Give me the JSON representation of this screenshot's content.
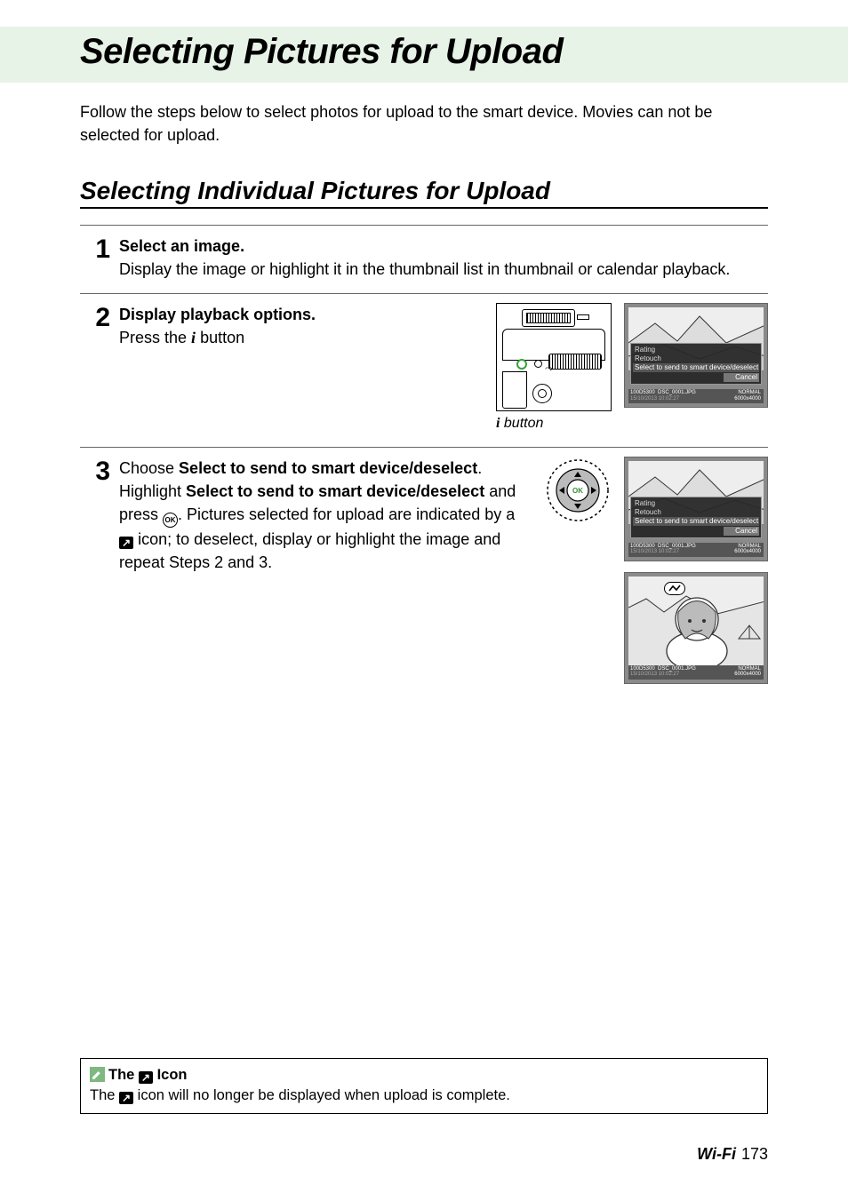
{
  "title": "Selecting Pictures for Upload",
  "intro": "Follow the steps below to select photos for upload to the smart device. Movies can not be selected for upload.",
  "subtitle": "Selecting Individual Pictures for Upload",
  "steps": {
    "s1": {
      "num": "1",
      "head": "Select an image.",
      "body": "Display the image or highlight it in the thumbnail list in thumbnail or calendar playback."
    },
    "s2": {
      "num": "2",
      "head": "Display playback options.",
      "body_pre": "Press the ",
      "i_symbol": "i",
      "body_post": " button",
      "caption_pre": "",
      "caption_i": "i",
      "caption_post": " button"
    },
    "s3": {
      "num": "3",
      "head_pre": "Choose ",
      "head_bold": "Select to send to smart device/deselect",
      "head_post": ".",
      "body_pre": "Highlight ",
      "body_bold": "Select to send to smart device/deselect",
      "body_mid": " and press ",
      "ok_label": "OK",
      "body_mid2": ". Pictures selected for upload are indicated by a ",
      "upload_icon": "✓",
      "body_post": " icon; to deselect, display or highlight the image and repeat Steps 2 and 3."
    }
  },
  "menu": {
    "rating": "Rating",
    "retouch": "Retouch",
    "select": "Select to send to smart device/deselect",
    "cancel": "Cancel"
  },
  "meta": {
    "folder": "100D5300",
    "file": "DSC_0001.JPG",
    "date": "15/10/2013 10:02:27",
    "quality": "NORMAL",
    "size": "6000x4000"
  },
  "note": {
    "title_pre": "The ",
    "title_post": " Icon",
    "body_pre": "The ",
    "body_post": " icon will no longer be displayed when upload is complete."
  },
  "footer": {
    "section": "Wi-Fi",
    "page": "173"
  }
}
